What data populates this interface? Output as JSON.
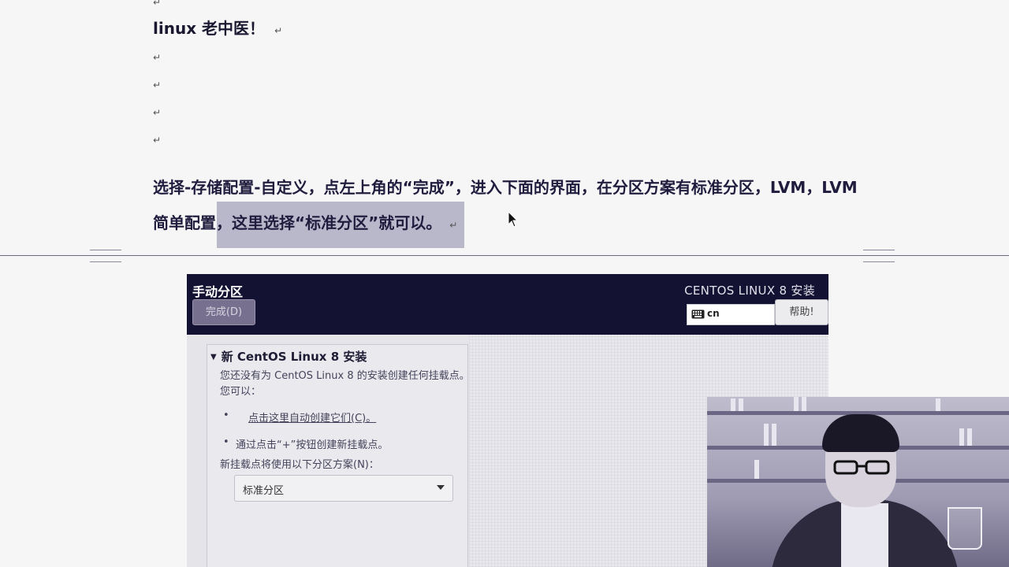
{
  "document": {
    "title": "linux  老中医！",
    "para_mark": "↵",
    "body_line1": "选择-存储配置-自定义，点左上角的“完成”，进入下面的界面，在分区方案有标准分区，LVM，LVM",
    "body_line2": "简单配置，这里选择“标准分区”就可以。"
  },
  "installer": {
    "title": "手动分区",
    "done_button": "完成(D)",
    "product_title": "CENTOS LINUX 8 安装",
    "keyboard_layout": "cn",
    "help_button": "帮助!",
    "section_title": "新 CentOS Linux 8 安装",
    "no_mount_text": "您还没有为 CentOS Linux 8 的安装创建任何挂载点。",
    "you_can": "您可以：",
    "auto_create_link": "点击这里自动创建它们(C)。",
    "plus_hint": "通过点击“+”按钮创建新挂载点。",
    "scheme_label": "新挂载点将使用以下分区方案(N)：",
    "scheme_value": "标准分区"
  },
  "colors": {
    "header_bg": "#141233",
    "highlight": "#b9b8cb"
  }
}
